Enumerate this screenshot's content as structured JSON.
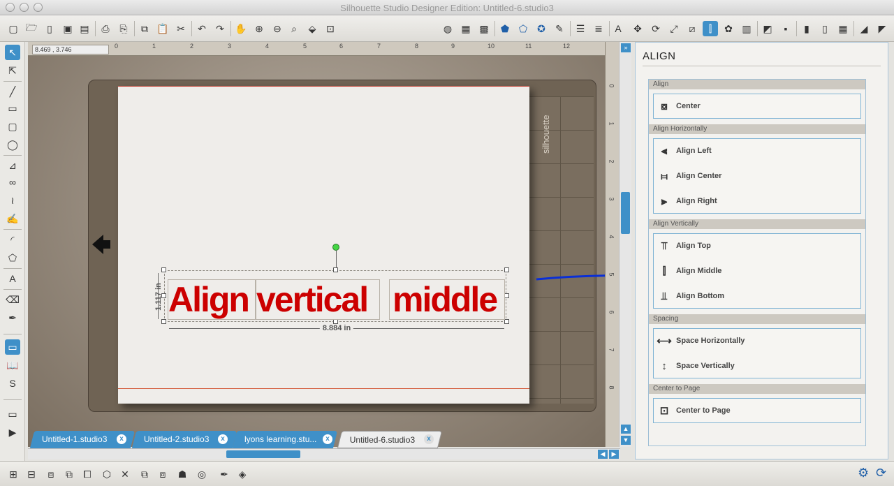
{
  "window": {
    "title": "Silhouette Studio Designer Edition: Untitled-6.studio3"
  },
  "ruler": {
    "coordinates": "8.469 , 3.746",
    "h_numbers": [
      "0",
      "1",
      "2",
      "3",
      "4",
      "5",
      "6",
      "7",
      "8",
      "9",
      "10",
      "11",
      "12"
    ],
    "v_numbers": [
      "0",
      "1",
      "2",
      "3",
      "4",
      "5",
      "6",
      "7",
      "8"
    ]
  },
  "mat": {
    "brand": "silhouette"
  },
  "design": {
    "words": [
      "Align",
      "vertical",
      "middle"
    ],
    "width_label": "8.884 in",
    "height_label": "1.117 in",
    "text_color": "#cc0000"
  },
  "tabs": [
    {
      "label": "Untitled-1.studio3",
      "close": "x"
    },
    {
      "label": "Untitled-2.studio3",
      "close": "x"
    },
    {
      "label": "lyons learning.stu...",
      "close": "x"
    },
    {
      "label": "Untitled-6.studio3",
      "close": "x"
    }
  ],
  "panel": {
    "title": "ALIGN",
    "sections": [
      {
        "heading": "Align",
        "buttons": [
          "Center"
        ]
      },
      {
        "heading": "Align Horizontally",
        "buttons": [
          "Align Left",
          "Align Center",
          "Align Right"
        ]
      },
      {
        "heading": "Align Vertically",
        "buttons": [
          "Align Top",
          "Align Middle",
          "Align Bottom"
        ]
      },
      {
        "heading": "Spacing",
        "buttons": [
          "Space Horizontally",
          "Space Vertically"
        ]
      },
      {
        "heading": "Center to Page",
        "buttons": [
          "Center to Page"
        ]
      }
    ]
  },
  "icons": {
    "toolbar": [
      "new-doc-icon",
      "open-folder-icon",
      "open-template-icon",
      "save-icon",
      "save-sd-icon",
      "print-icon",
      "print-cut-icon",
      "copy-icon",
      "paste-icon",
      "cut-icon",
      "undo-icon",
      "redo-icon",
      "pan-hand-icon",
      "zoom-in-icon",
      "zoom-out-icon",
      "zoom-select-icon",
      "zoom-fit-icon",
      "zoom-page-icon"
    ],
    "accent": "#3f90c8"
  }
}
